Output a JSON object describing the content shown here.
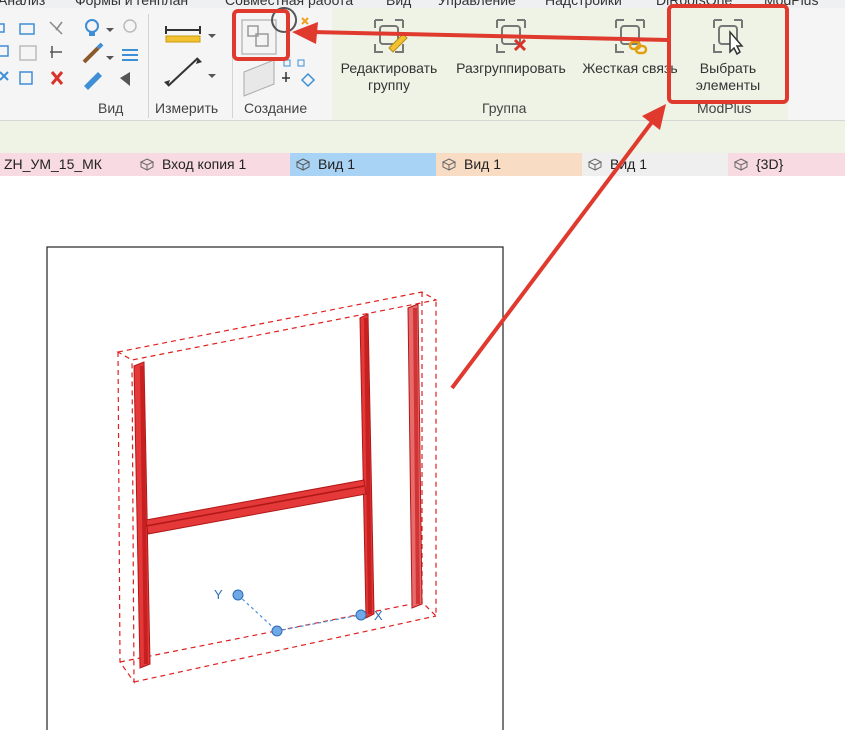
{
  "menu": [
    "Анализ",
    "Формы и генплан",
    "Совместная работа",
    "Вид",
    "Управление",
    "Надстройки",
    "DiRootsOne",
    "ModPlus"
  ],
  "ribbon": {
    "groups": {
      "view": "Вид",
      "measure": "Измерить",
      "create": "Создание",
      "group": "Группа",
      "modplus": "ModPlus"
    },
    "buttons": {
      "edit_group": [
        "Редактировать",
        "группу"
      ],
      "ungroup": "Разгруппировать",
      "rigid_link": "Жесткая связь",
      "select_elements": [
        "Выбрать",
        "элементы"
      ]
    }
  },
  "tabs": [
    {
      "label": "ZH_УМ_15_МК",
      "color": "#f8dbe2"
    },
    {
      "label": "Вход копия 1",
      "color": "#f8dbe2"
    },
    {
      "label": "Вид 1",
      "color": "#a9d3f5"
    },
    {
      "label": "Вид 1",
      "color": "#f9dcc4"
    },
    {
      "label": "Вид 1",
      "color": "#efefef"
    },
    {
      "label": "{3D}",
      "color": "#f8dbe2"
    }
  ],
  "canvas": {
    "axis_x": "X",
    "axis_y": "Y"
  },
  "colors": {
    "highlight": "#e03a2f",
    "selected": "#e02020",
    "accent": "#3e8fd6"
  }
}
